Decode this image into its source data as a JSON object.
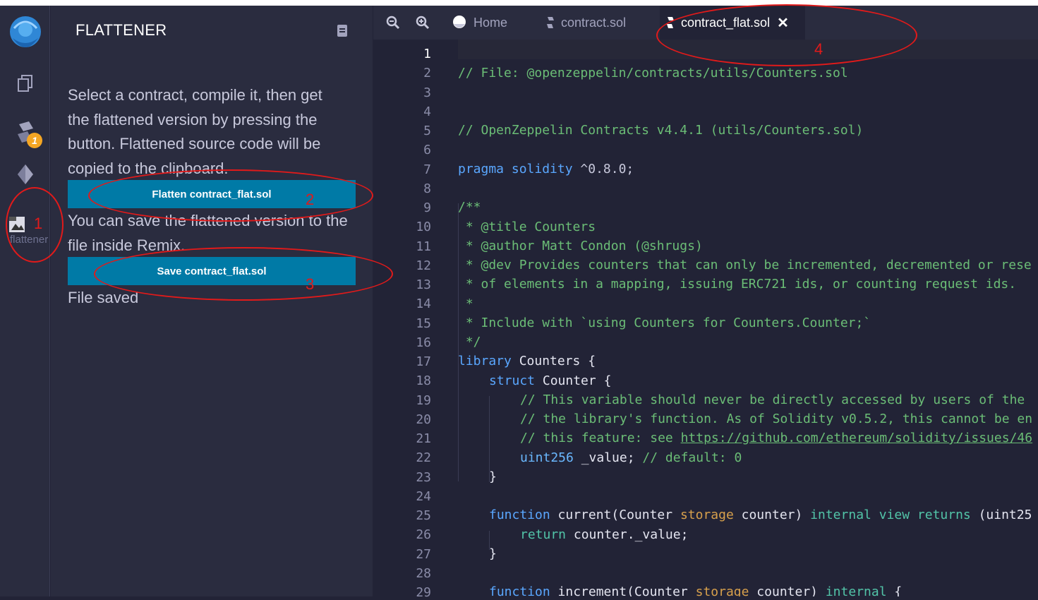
{
  "sidebar": {
    "plugin_label": "flattener",
    "compile_badge": "1"
  },
  "panel": {
    "title": "FLATTENER",
    "description": "Select a contract, compile it, then get the flattened version by pressing the button. Flattened source code will be copied to the clipboard.",
    "flatten_button": "Flatten contract_flat.sol",
    "save_description": "You can save the flattened version to the file inside Remix.",
    "save_button": "Save contract_flat.sol",
    "status": "File saved"
  },
  "tabs": [
    {
      "label": "Home"
    },
    {
      "label": "contract.sol"
    },
    {
      "label": "contract_flat.sol",
      "active": true
    }
  ],
  "annotations": [
    "1",
    "2",
    "3",
    "4"
  ],
  "code": {
    "line_numbers": [
      "1",
      "2",
      "3",
      "4",
      "5",
      "6",
      "7",
      "8",
      "9",
      "10",
      "11",
      "12",
      "13",
      "14",
      "15",
      "16",
      "17",
      "18",
      "19",
      "20",
      "21",
      "22",
      "23",
      "24",
      "25",
      "26",
      "27",
      "28",
      "29"
    ],
    "l2": "// File: @openzeppelin/contracts/utils/Counters.sol",
    "l5": "// OpenZeppelin Contracts v4.4.1 (utils/Counters.sol)",
    "l7_kw": "pragma solidity",
    "l7_val": " ^0.8.0;",
    "l9": "/**",
    "l10": " * @title Counters",
    "l11": " * @author Matt Condon (@shrugs)",
    "l12": " * @dev Provides counters that can only be incremented, decremented or rese",
    "l13": " * of elements in a mapping, issuing ERC721 ids, or counting request ids.",
    "l14": " *",
    "l15": " * Include with `using Counters for Counters.Counter;`",
    "l16": " */",
    "l17_kw": "library",
    "l17_rest": " Counters {",
    "l18_kw": "struct",
    "l18_rest": " Counter {",
    "l19": "// This variable should never be directly accessed by users of the",
    "l20": "// the library's function. As of Solidity v0.5.2, this cannot be en",
    "l21_pre": "// this feature: see ",
    "l21_link": "https://github.com/ethereum/solidity/issues/46",
    "l22_ty": "uint256",
    "l22_rest": " _value; ",
    "l22_com": "// default: 0",
    "l23": "}",
    "l25_kw": "function",
    "l25_fn": " current(Counter ",
    "l25_st": "storage",
    "l25_rest": " counter) ",
    "l25_mod": "internal view returns",
    "l25_end": " (uint25",
    "l26_kw": "return",
    "l26_rest": " counter._value;",
    "l27": "}",
    "l29_kw": "function",
    "l29_fn": " increment(Counter ",
    "l29_st": "storage",
    "l29_rest": " counter) ",
    "l29_mod": "internal",
    "l29_end": " {"
  },
  "icons": [
    "remix-logo-icon",
    "file-explorer-icon",
    "solidity-compiler-icon",
    "deploy-icon",
    "flattener-icon",
    "book-icon",
    "zoom-out-icon",
    "zoom-in-icon",
    "home-icon",
    "solidity-file-icon",
    "close-icon"
  ],
  "colors": {
    "accent": "#007aa6",
    "annotation": "#e21a1a",
    "badge": "#f5a623"
  }
}
